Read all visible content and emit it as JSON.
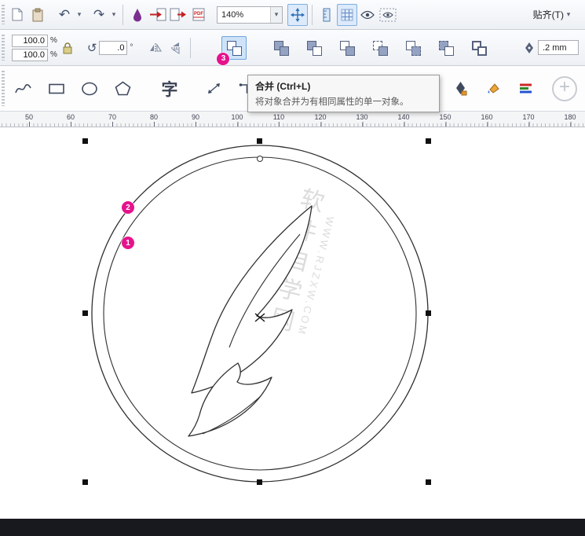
{
  "toolbar": {
    "zoom_value": "140%",
    "snap_label": "贴齐(T)",
    "undo_glyph": "↶",
    "redo_glyph": "↷",
    "rotate_glyph": "↺",
    "caret_glyph": "▾",
    "pdf_label": "PDF"
  },
  "property_bar": {
    "scale_x": "100.0",
    "scale_y": "100.0",
    "percent": "%",
    "angle_value": ".0",
    "angle_unit": "°",
    "step_badge_3": "3",
    "outline_width": ".2 mm"
  },
  "toolbox": {
    "text_tool_label": "字",
    "add_glyph": "+"
  },
  "tooltip": {
    "title": "合并 (Ctrl+L)",
    "body": "将对象合并为有相同属性的单一对象。"
  },
  "ruler": {
    "ticks": [
      "50",
      "60",
      "70",
      "80",
      "90",
      "100",
      "110",
      "120",
      "130",
      "140",
      "150",
      "160",
      "170",
      "180"
    ]
  },
  "canvas": {
    "step_badge_1": "1",
    "step_badge_2": "2",
    "watermark_cn": "软件自学网",
    "watermark_en": "WWW.RJZXW.COM"
  },
  "colors": {
    "badge_magenta": "#e6128c",
    "accent_blue": "#2e6fb7",
    "selection_highlight": "#cfe3f8",
    "outline_black": "#2f2f2f"
  }
}
